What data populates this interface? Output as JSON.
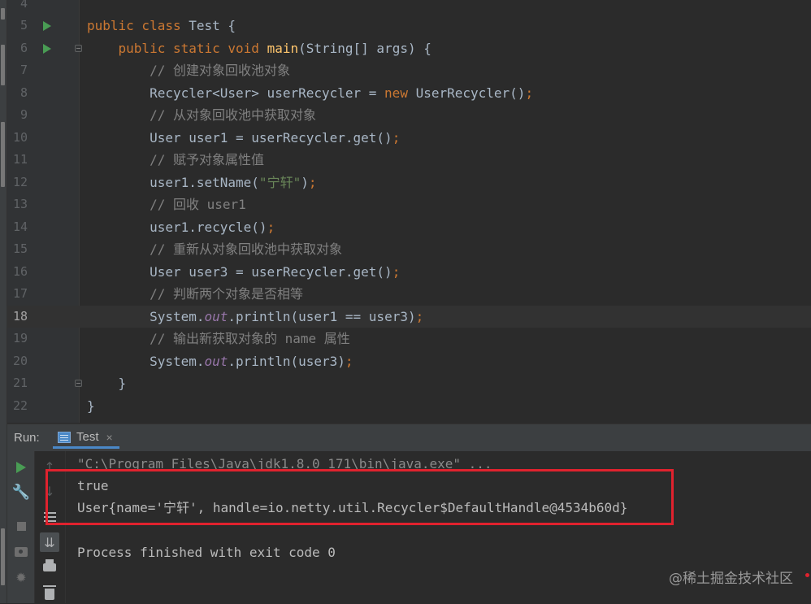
{
  "editor": {
    "lines": [
      {
        "num": "4",
        "tokens": []
      },
      {
        "num": "5",
        "run": true,
        "tokens": [
          {
            "t": "public class ",
            "c": "kw"
          },
          {
            "t": "Test {"
          }
        ]
      },
      {
        "num": "6",
        "run": true,
        "fold": true,
        "tokens": [
          {
            "t": "    "
          },
          {
            "t": "public static void ",
            "c": "kw"
          },
          {
            "t": "main",
            "c": "fn"
          },
          {
            "t": "(String[] args) {"
          }
        ]
      },
      {
        "num": "7",
        "tokens": [
          {
            "t": "        // ",
            "c": "cm"
          },
          {
            "t": "创建对象回收池对象",
            "c": "cm cjk"
          }
        ]
      },
      {
        "num": "8",
        "tokens": [
          {
            "t": "        Recycler<User> userRecycler = "
          },
          {
            "t": "new ",
            "c": "kw"
          },
          {
            "t": "UserRecycler()"
          },
          {
            "t": ";",
            "c": "kw"
          }
        ]
      },
      {
        "num": "9",
        "tokens": [
          {
            "t": "        // ",
            "c": "cm"
          },
          {
            "t": "从对象回收池中获取对象",
            "c": "cm cjk"
          }
        ]
      },
      {
        "num": "10",
        "tokens": [
          {
            "t": "        User user1 = userRecycler.get()"
          },
          {
            "t": ";",
            "c": "kw"
          }
        ]
      },
      {
        "num": "11",
        "tokens": [
          {
            "t": "        // ",
            "c": "cm"
          },
          {
            "t": "赋予对象属性值",
            "c": "cm cjk"
          }
        ]
      },
      {
        "num": "12",
        "tokens": [
          {
            "t": "        user1.setName("
          },
          {
            "t": "\"",
            "c": "st"
          },
          {
            "t": "宁轩",
            "c": "st cjk"
          },
          {
            "t": "\"",
            "c": "st"
          },
          {
            "t": ")"
          },
          {
            "t": ";",
            "c": "kw"
          }
        ]
      },
      {
        "num": "13",
        "tokens": [
          {
            "t": "        // ",
            "c": "cm"
          },
          {
            "t": "回收",
            "c": "cm cjk"
          },
          {
            "t": " user1",
            "c": "cm"
          }
        ]
      },
      {
        "num": "14",
        "tokens": [
          {
            "t": "        user1.recycle()"
          },
          {
            "t": ";",
            "c": "kw"
          }
        ]
      },
      {
        "num": "15",
        "tokens": [
          {
            "t": "        // ",
            "c": "cm"
          },
          {
            "t": "重新从对象回收池中获取对象",
            "c": "cm cjk"
          }
        ]
      },
      {
        "num": "16",
        "tokens": [
          {
            "t": "        User user3 = userRecycler.get()"
          },
          {
            "t": ";",
            "c": "kw"
          }
        ]
      },
      {
        "num": "17",
        "tokens": [
          {
            "t": "        // ",
            "c": "cm"
          },
          {
            "t": "判断两个对象是否相等",
            "c": "cm cjk"
          }
        ]
      },
      {
        "num": "18",
        "current": true,
        "tokens": [
          {
            "t": "        System."
          },
          {
            "t": "out",
            "c": "it"
          },
          {
            "t": ".println(user1 == user3)"
          },
          {
            "t": ";",
            "c": "kw"
          }
        ]
      },
      {
        "num": "19",
        "tokens": [
          {
            "t": "        // ",
            "c": "cm"
          },
          {
            "t": "输出新获取对象的",
            "c": "cm cjk"
          },
          {
            "t": " name ",
            "c": "cm"
          },
          {
            "t": "属性",
            "c": "cm cjk"
          }
        ]
      },
      {
        "num": "20",
        "tokens": [
          {
            "t": "        System."
          },
          {
            "t": "out",
            "c": "it"
          },
          {
            "t": ".println(user3)"
          },
          {
            "t": ";",
            "c": "kw"
          }
        ]
      },
      {
        "num": "21",
        "fold": true,
        "tokens": [
          {
            "t": "    }"
          }
        ]
      },
      {
        "num": "22",
        "tokens": [
          {
            "t": "}"
          }
        ]
      }
    ]
  },
  "run_panel": {
    "label": "Run:",
    "tab_label": "Test",
    "tab_close": "×"
  },
  "console": {
    "command": "\"C:\\Program Files\\Java\\jdk1.8.0_171\\bin\\java.exe\" ...",
    "line1": "true",
    "line2_pre": "User{name='",
    "line2_cjk": "宁轩",
    "line2_post": "', handle=io.netty.util.Recycler$DefaultHandle@4534b60d}",
    "finished": "Process finished with exit code 0"
  },
  "watermark": "@稀土掘金技术社区",
  "colors": {
    "highlight_box": "#e0222e",
    "run_green": "#499c54",
    "keyword": "#cc7832",
    "comment": "#808080",
    "string": "#6a8759"
  }
}
